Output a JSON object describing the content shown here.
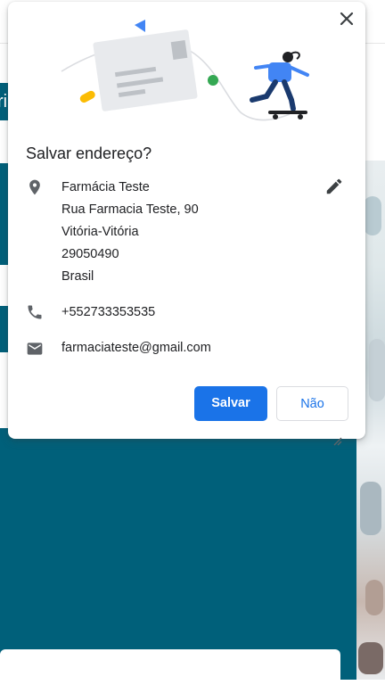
{
  "background": {
    "tab_fragment": "ri",
    "colors": {
      "teal": "#00607a"
    }
  },
  "dialog": {
    "title": "Salvar endereço?",
    "close_icon": "close-icon",
    "edit_icon": "pencil-icon",
    "address": {
      "icon": "location-pin-icon",
      "lines": [
        "Farmácia Teste",
        "Rua Farmacia Teste, 90",
        "Vitória-Vitória",
        "29050490",
        "Brasil"
      ]
    },
    "phone": {
      "icon": "phone-icon",
      "value": "+552733353535"
    },
    "email": {
      "icon": "mail-icon",
      "value": "farmaciateste@gmail.com"
    },
    "buttons": {
      "save_label": "Salvar",
      "no_label": "Não"
    },
    "colors": {
      "accent": "#1a73e8",
      "text": "#202124",
      "icon": "#5f6368"
    }
  }
}
